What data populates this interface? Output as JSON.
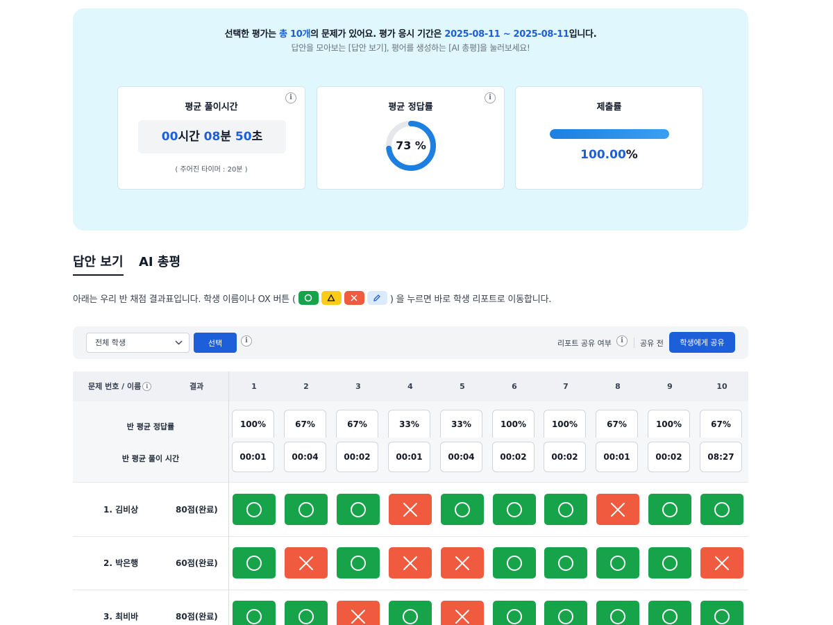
{
  "intro": {
    "line1_a": "선택한 평가는 ",
    "line1_count": "총 10개",
    "line1_b": "의 문제가 있어요. 평가 응시 기간은 ",
    "line1_period": "2025-08-11 ~ 2025-08-11",
    "line1_c": "입니다.",
    "line2": "답안을 모아보는 [답안 보기], 평어를 생성하는 [AI 총평]을 눌러보세요!"
  },
  "cards": {
    "avg_time": {
      "title": "평균 풀이시간",
      "hours": "00",
      "hours_unit": "시간 ",
      "minutes": "08",
      "minutes_unit": "분 ",
      "seconds": "50",
      "seconds_unit": "초",
      "note": "( 주어진 타이머 : 20분 )"
    },
    "avg_correct": {
      "title": "평균 정답률",
      "value": 73,
      "label": "73 %"
    },
    "submit_rate": {
      "title": "제출률",
      "value": 100,
      "value_text": "100.00",
      "unit": "%"
    }
  },
  "tabs": {
    "answers": "답안 보기",
    "ai": "AI 총평"
  },
  "description": {
    "before": "아래는 우리 반 채점 결과표입니다. 학생 이름이나 OX 버튼 (",
    "after": ") 을 누르면 바로 학생 리포트로 이동합니다."
  },
  "filter": {
    "select_value": "전체 학생",
    "select_button": "선택",
    "share_label": "리포트 공유 여부",
    "share_status": "공유 전",
    "share_button": "학생에게 공유"
  },
  "table": {
    "header_problem": "문제 번호 / 이름",
    "header_result": "결과",
    "question_numbers": [
      "1",
      "2",
      "3",
      "4",
      "5",
      "6",
      "7",
      "8",
      "9",
      "10"
    ],
    "avg_rate_label": "반 평균 정답률",
    "avg_time_label": "반 평균 풀이 시간",
    "avg_rates": [
      "100%",
      "67%",
      "67%",
      "33%",
      "33%",
      "100%",
      "100%",
      "67%",
      "100%",
      "67%"
    ],
    "avg_times": [
      "00:01",
      "00:04",
      "00:02",
      "00:01",
      "00:04",
      "00:02",
      "00:02",
      "00:01",
      "00:02",
      "08:27"
    ],
    "students": [
      {
        "name": "1. 김비상",
        "score": "80점(완료)",
        "results": [
          "O",
          "O",
          "O",
          "X",
          "O",
          "O",
          "O",
          "X",
          "O",
          "O"
        ]
      },
      {
        "name": "2. 박은행",
        "score": "60점(완료)",
        "results": [
          "O",
          "X",
          "O",
          "X",
          "X",
          "O",
          "O",
          "O",
          "O",
          "X"
        ]
      },
      {
        "name": "3. 최비바",
        "score": "80점(완료)",
        "results": [
          "O",
          "O",
          "X",
          "O",
          "X",
          "O",
          "O",
          "O",
          "O",
          "O"
        ]
      }
    ]
  },
  "colors": {
    "accent": "#1d5fd8",
    "correct": "#16a34a",
    "wrong": "#f05a3f",
    "panel": "#dff7fd"
  }
}
